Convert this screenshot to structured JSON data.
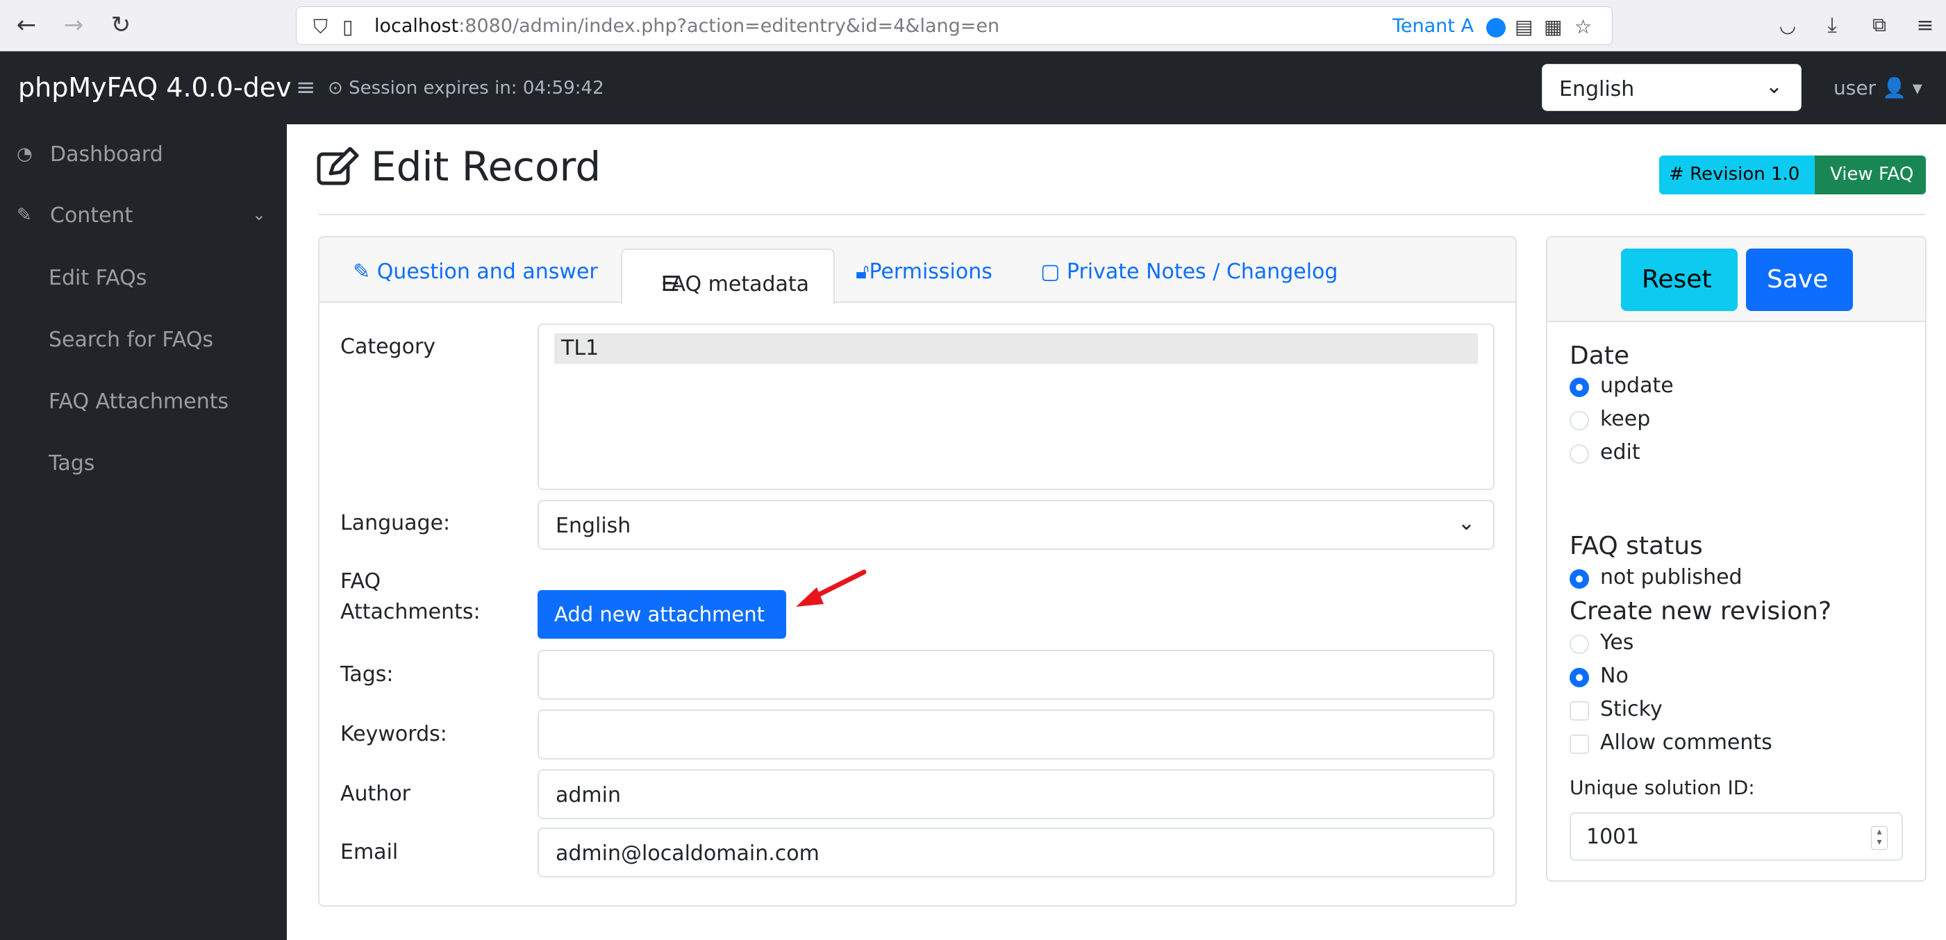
{
  "browser": {
    "url_host": "localhost",
    "url_rest": ":8080/admin/index.php?action=editentry&id=4&lang=en",
    "tenant": "Tenant A"
  },
  "navbar": {
    "brand": "phpMyFAQ 4.0.0-dev",
    "session": "Session expires in: 04:59:42",
    "language": "English",
    "user": "user"
  },
  "sidebar": {
    "items": [
      {
        "label": "Dashboard",
        "icon": "dashboard-icon"
      },
      {
        "label": "Content",
        "icon": "edit-icon"
      },
      {
        "label": "Edit FAQs"
      },
      {
        "label": "Search for FAQs"
      },
      {
        "label": "FAQ Attachments"
      },
      {
        "label": "Tags"
      }
    ]
  },
  "page": {
    "title": "Edit Record",
    "revision": "Revision 1.0",
    "view_faq": "View FAQ"
  },
  "tabs": [
    {
      "label": "Question and answer"
    },
    {
      "label": "FAQ metadata"
    },
    {
      "label": "Permissions"
    },
    {
      "label": "Private Notes / Changelog"
    }
  ],
  "form": {
    "category_label": "Category",
    "category_selected": "TL1",
    "language_label": "Language:",
    "language_value": "English",
    "attachments_label_1": "FAQ",
    "attachments_label_2": "Attachments:",
    "add_attachment": "Add new attachment",
    "tags_label": "Tags:",
    "tags_value": "",
    "keywords_label": "Keywords:",
    "keywords_value": "",
    "author_label": "Author",
    "author_value": "admin",
    "email_label": "Email",
    "email_value": "admin@localdomain.com"
  },
  "side_panel": {
    "reset": "Reset",
    "save": "Save",
    "date_heading": "Date",
    "date_options": [
      "update",
      "keep",
      "edit"
    ],
    "date_selected": "update",
    "status_heading": "FAQ status",
    "status_option": "not published",
    "revision_heading": "Create new revision?",
    "revision_options": [
      "Yes",
      "No"
    ],
    "revision_selected": "No",
    "sticky": "Sticky",
    "allow_comments": "Allow comments",
    "solution_id_label": "Unique solution ID:",
    "solution_id_value": "1001"
  },
  "colors": {
    "primary": "#0d6efd",
    "info": "#0dcaf0",
    "success": "#198754",
    "dark": "#212529"
  }
}
